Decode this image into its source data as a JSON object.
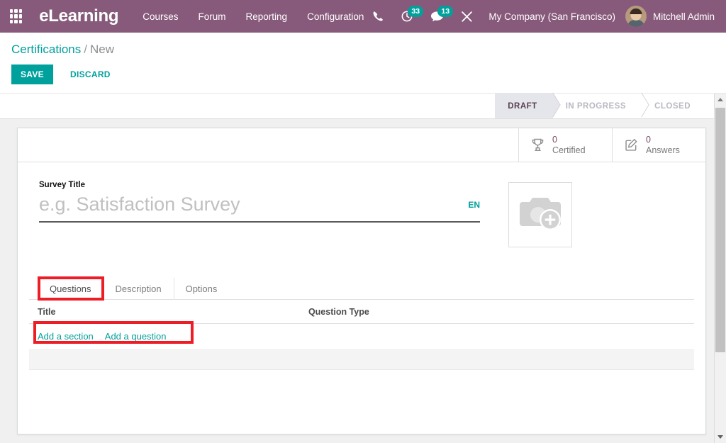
{
  "navbar": {
    "apps_icon": "apps-grid-icon",
    "brand": "eLearning",
    "menu": [
      {
        "label": "Courses"
      },
      {
        "label": "Forum"
      },
      {
        "label": "Reporting"
      },
      {
        "label": "Configuration"
      }
    ],
    "phone_icon": "phone-icon",
    "activities": {
      "icon": "clock-icon",
      "count": "33"
    },
    "messages": {
      "icon": "chat-bubble-icon",
      "count": "13"
    },
    "tools_icon": "wrench-screwdriver-icon",
    "company": "My Company (San Francisco)",
    "user": "Mitchell Admin",
    "avatar_icon": "user-avatar"
  },
  "control_panel": {
    "breadcrumb_root": "Certifications",
    "breadcrumb_sep": "/",
    "breadcrumb_current": "New",
    "save_label": "SAVE",
    "discard_label": "DISCARD"
  },
  "statusbar": {
    "steps": [
      {
        "label": "DRAFT",
        "active": true
      },
      {
        "label": "IN PROGRESS",
        "active": false
      },
      {
        "label": "CLOSED",
        "active": false
      }
    ]
  },
  "stat_buttons": [
    {
      "icon": "trophy-icon",
      "value": "0",
      "label": "Certified"
    },
    {
      "icon": "pencil-square-icon",
      "value": "0",
      "label": "Answers"
    }
  ],
  "form": {
    "title_label": "Survey Title",
    "title_value": "",
    "title_placeholder": "e.g. Satisfaction Survey",
    "language_badge": "EN",
    "image_icon": "camera-add-icon"
  },
  "notebook": {
    "tabs": [
      {
        "label": "Questions",
        "active": true
      },
      {
        "label": "Description",
        "active": false
      },
      {
        "label": "Options",
        "active": false
      }
    ],
    "table": {
      "headers": [
        "Title",
        "Question Type"
      ],
      "rows": [],
      "add_section_label": "Add a section",
      "add_question_label": "Add a question"
    }
  },
  "scrollbar": {
    "up_arrow": "scroll-up-arrow",
    "down_arrow": "scroll-down-arrow"
  },
  "colors": {
    "brand_purple": "#875A7B",
    "accent_teal": "#00A09D",
    "annotation_red": "#EE1C25",
    "status_active_bg": "#E4E6EB"
  }
}
